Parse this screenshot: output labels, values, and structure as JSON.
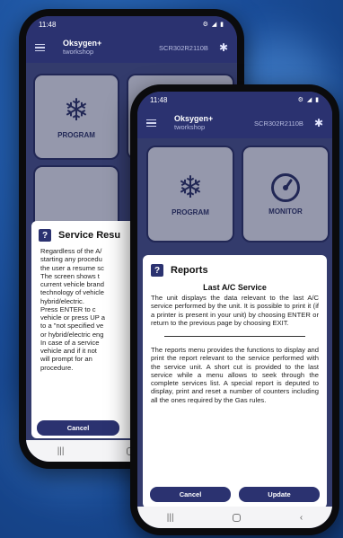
{
  "back_phone": {
    "status_time": "11:48",
    "status_icons": "⚙ ◢ ▮",
    "brand_name": "Oksygen+",
    "brand_sub": "tworkshop",
    "serial": "SCR302R2110B",
    "tile_program_label": "PROGRAM",
    "dialog": {
      "title": "Service Resu",
      "lines": [
        "Regardless of the A/",
        "starting any procedu",
        "the user a resume sc",
        "The screen shows t",
        "current vehicle brand",
        "technology of vehicle",
        "hybrid/electric.",
        "Press ENTER to c",
        "vehicle or press UP a",
        "to a \"not specified ve",
        "or hybrid/electric eng",
        "In case of a service",
        "vehicle and if it not",
        "will prompt for an",
        "procedure."
      ],
      "cancel_label": "Cancel"
    },
    "nav_recent": "|||"
  },
  "front_phone": {
    "status_time": "11:48",
    "status_icons": "⚙ ◢ ▮",
    "brand_name": "Oksygen+",
    "brand_sub": "tworkshop",
    "serial": "SCR302R2110B",
    "tile_program_label": "PROGRAM",
    "tile_monitor_label": "MONITOR",
    "dialog": {
      "title": "Reports",
      "section_title": "Last A/C Service",
      "paragraph1": "The unit displays the data relevant to the last A/C service performed by the unit. It is possible to print it (if a printer is present in your unit) by choosing ENTER or return to the previous page by choosing EXIT.",
      "paragraph2": "The reports menu provides the functions to display and print the report relevant to the service performed with the service unit. A short cut is provided to the last service while a menu allows to seek through the complete services list. A special report is deputed to display, print and reset a number of counters including all the ones required by the Gas rules.",
      "cancel_label": "Cancel",
      "update_label": "Update"
    },
    "nav_recent": "|||",
    "nav_back": "‹"
  },
  "icons": {
    "program": "snowflake-icon",
    "monitor": "gauge-icon",
    "bluetooth": "bluetooth-icon",
    "menu": "hamburger-menu-icon",
    "question": "question-icon"
  },
  "colors": {
    "brand_navy": "#2b3270",
    "screen_bg": "#3d4884",
    "tile_bg": "#eef0f8"
  }
}
